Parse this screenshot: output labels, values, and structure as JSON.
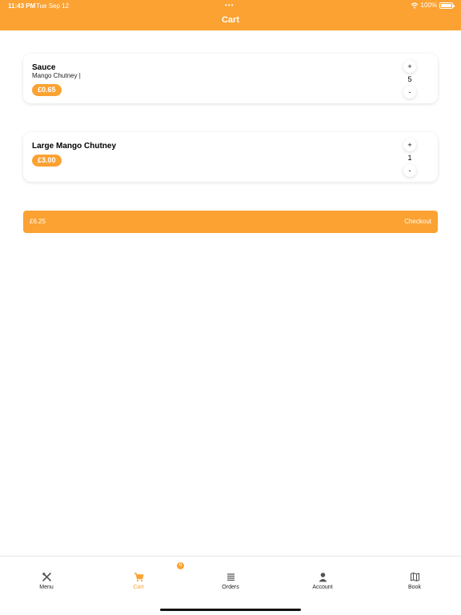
{
  "status": {
    "time": "11:43 PM",
    "date": "Tue Sep 12",
    "dots": "•••",
    "battery": "100%"
  },
  "nav": {
    "title": "Cart"
  },
  "cart": {
    "items": [
      {
        "name": "Sauce",
        "description": "Mango Chutney |",
        "price": "£0.65",
        "quantity": "5",
        "plus": "+",
        "minus": "-"
      },
      {
        "name": "Large Mango Chutney",
        "description": "",
        "price": "£3.00",
        "quantity": "1",
        "plus": "+",
        "minus": "-"
      }
    ],
    "total": "£6.25",
    "checkout_label": "Checkout"
  },
  "tabbar": {
    "cart_badge": "6",
    "tabs": [
      {
        "label": "Menu",
        "icon": "utensils-icon"
      },
      {
        "label": "Cart",
        "icon": "cart-icon"
      },
      {
        "label": "Orders",
        "icon": "list-icon"
      },
      {
        "label": "Account",
        "icon": "person-icon"
      },
      {
        "label": "Book",
        "icon": "map-icon"
      }
    ]
  },
  "colors": {
    "accent": "#fba232",
    "background": "#ffffff",
    "text": "#111111"
  }
}
